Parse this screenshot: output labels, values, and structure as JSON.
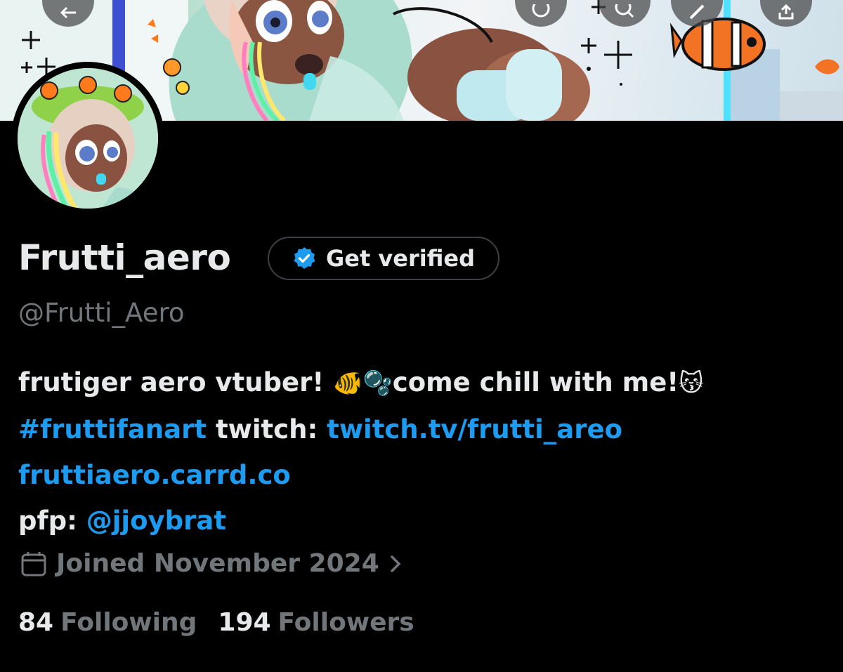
{
  "profile": {
    "display_name": "Frutti_aero",
    "handle": "@Frutti_Aero",
    "verify_button_label": "Get verified",
    "bio": {
      "line1_text": "frutiger aero vtuber! ",
      "line1_emojis": "🐠🫧",
      "line1_text2": "come chill with me!",
      "line1_emoji_end": "😽",
      "hashtag": "#fruttifanart",
      "twitch_label": " twitch: ",
      "twitch_link": "twitch.tv/frutti_areo",
      "carrd_link": "fruttiaero.carrd.co",
      "pfp_label": "pfp: ",
      "pfp_mention": "@jjoybrat"
    },
    "joined": "Joined November 2024",
    "following_count": "84",
    "following_label": "Following",
    "followers_count": "194",
    "followers_label": "Followers"
  },
  "icons": {
    "back": "back-arrow-icon",
    "grok": "grok-icon",
    "search": "search-icon",
    "edit": "edit-icon",
    "share": "share-icon",
    "verified": "verified-badge-icon",
    "calendar": "calendar-icon",
    "chevron": "chevron-right-icon"
  },
  "colors": {
    "background": "#000000",
    "text_primary": "#e7e9ea",
    "text_secondary": "#71767b",
    "link": "#1d9bf0",
    "verified_blue": "#1d9bf0"
  }
}
